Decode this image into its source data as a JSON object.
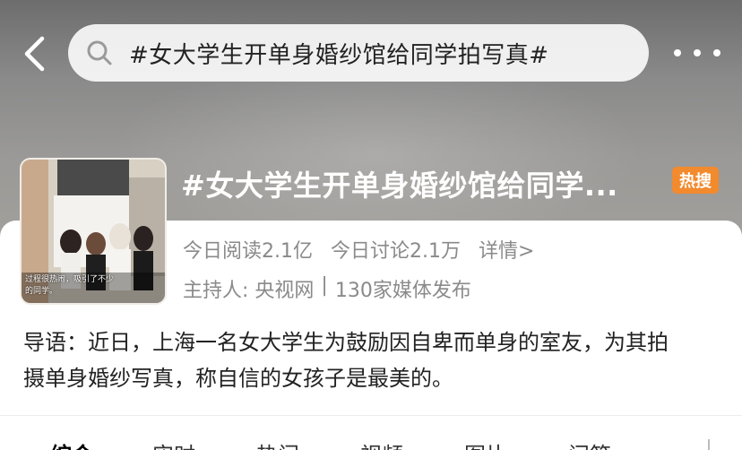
{
  "header": {
    "search_query": "#女大学生开单身婚纱馆给同学拍写真#"
  },
  "topic": {
    "title": "#女大学生开单身婚纱馆给同学...",
    "badge": "热搜",
    "thumbnail_caption_line1": "过程很热闹，吸引了不少",
    "thumbnail_caption_line2": "的同学。"
  },
  "stats": {
    "reads": "今日阅读2.1亿",
    "discussions": "今日讨论2.1万",
    "detail": "详情>"
  },
  "host": {
    "label": "主持人: 央视网",
    "separator": "|",
    "media": "130家媒体发布"
  },
  "intro": {
    "text": "导语：近日，上海一名女大学生为鼓励因自卑而单身的室友，为其拍摄单身婚纱写真，称自信的女孩子是最美的。"
  },
  "tabs": [
    {
      "label": "综合"
    },
    {
      "label": "实时"
    },
    {
      "label": "热门"
    },
    {
      "label": "视频"
    },
    {
      "label": "图片"
    },
    {
      "label": "问答"
    }
  ],
  "colors": {
    "badge": "#f28a2e",
    "meta_text": "#8a8a8a"
  }
}
